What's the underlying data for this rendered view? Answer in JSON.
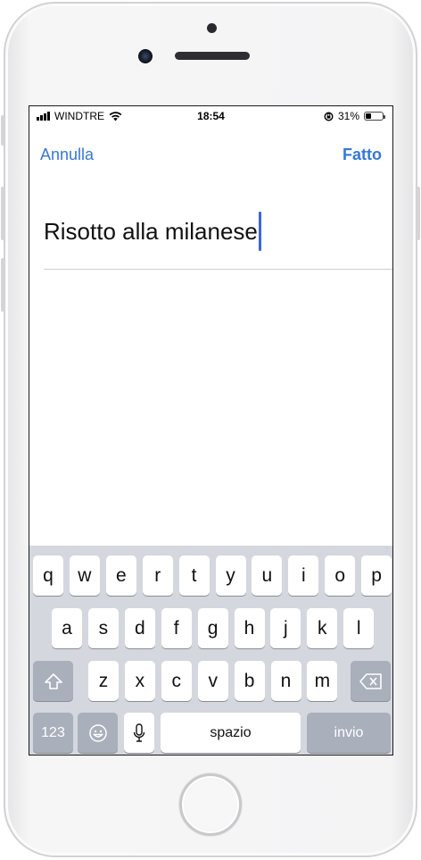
{
  "status_bar": {
    "carrier": "WINDTRE",
    "time": "18:54",
    "battery_percent": "31%",
    "battery_level": 0.31,
    "icons": [
      "signal-icon",
      "wifi-icon",
      "rotation-lock-icon",
      "battery-icon"
    ]
  },
  "nav": {
    "cancel_label": "Annulla",
    "done_label": "Fatto",
    "accent_color": "#3478d8"
  },
  "editor": {
    "value": "Risotto alla milanese"
  },
  "keyboard": {
    "row1": [
      "q",
      "w",
      "e",
      "r",
      "t",
      "y",
      "u",
      "i",
      "o",
      "p"
    ],
    "row2": [
      "a",
      "s",
      "d",
      "f",
      "g",
      "h",
      "j",
      "k",
      "l"
    ],
    "row3": [
      "z",
      "x",
      "c",
      "v",
      "b",
      "n",
      "m"
    ],
    "numbers_label": "123",
    "space_label": "spazio",
    "return_label": "invio",
    "icons": [
      "shift-icon",
      "backspace-icon",
      "emoji-icon",
      "microphone-icon"
    ]
  }
}
